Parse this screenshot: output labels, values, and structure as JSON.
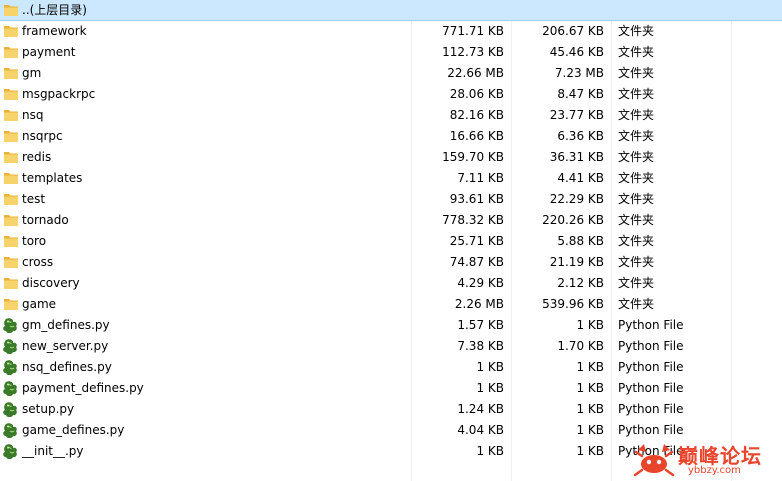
{
  "parent": {
    "label": "..(上层目录)",
    "icon": "folder-icon"
  },
  "columns": {},
  "rows": [
    {
      "name": "framework",
      "size": "771.71 KB",
      "packed": "206.67 KB",
      "type": "文件夹",
      "icon": "folder-icon"
    },
    {
      "name": "payment",
      "size": "112.73 KB",
      "packed": "45.46 KB",
      "type": "文件夹",
      "icon": "folder-icon"
    },
    {
      "name": "gm",
      "size": "22.66 MB",
      "packed": "7.23 MB",
      "type": "文件夹",
      "icon": "folder-icon"
    },
    {
      "name": "msgpackrpc",
      "size": "28.06 KB",
      "packed": "8.47 KB",
      "type": "文件夹",
      "icon": "folder-icon"
    },
    {
      "name": "nsq",
      "size": "82.16 KB",
      "packed": "23.77 KB",
      "type": "文件夹",
      "icon": "folder-icon"
    },
    {
      "name": "nsqrpc",
      "size": "16.66 KB",
      "packed": "6.36 KB",
      "type": "文件夹",
      "icon": "folder-icon"
    },
    {
      "name": "redis",
      "size": "159.70 KB",
      "packed": "36.31 KB",
      "type": "文件夹",
      "icon": "folder-icon"
    },
    {
      "name": "templates",
      "size": "7.11 KB",
      "packed": "4.41 KB",
      "type": "文件夹",
      "icon": "folder-icon"
    },
    {
      "name": "test",
      "size": "93.61 KB",
      "packed": "22.29 KB",
      "type": "文件夹",
      "icon": "folder-icon"
    },
    {
      "name": "tornado",
      "size": "778.32 KB",
      "packed": "220.26 KB",
      "type": "文件夹",
      "icon": "folder-icon"
    },
    {
      "name": "toro",
      "size": "25.71 KB",
      "packed": "5.88 KB",
      "type": "文件夹",
      "icon": "folder-icon"
    },
    {
      "name": "cross",
      "size": "74.87 KB",
      "packed": "21.19 KB",
      "type": "文件夹",
      "icon": "folder-icon"
    },
    {
      "name": "discovery",
      "size": "4.29 KB",
      "packed": "2.12 KB",
      "type": "文件夹",
      "icon": "folder-icon"
    },
    {
      "name": "game",
      "size": "2.26 MB",
      "packed": "539.96 KB",
      "type": "文件夹",
      "icon": "folder-icon"
    },
    {
      "name": "gm_defines.py",
      "size": "1.57 KB",
      "packed": "1 KB",
      "type": "Python File",
      "icon": "python-file-icon"
    },
    {
      "name": "new_server.py",
      "size": "7.38 KB",
      "packed": "1.70 KB",
      "type": "Python File",
      "icon": "python-file-icon"
    },
    {
      "name": "nsq_defines.py",
      "size": "1 KB",
      "packed": "1 KB",
      "type": "Python File",
      "icon": "python-file-icon"
    },
    {
      "name": "payment_defines.py",
      "size": "1 KB",
      "packed": "1 KB",
      "type": "Python File",
      "icon": "python-file-icon"
    },
    {
      "name": "setup.py",
      "size": "1.24 KB",
      "packed": "1 KB",
      "type": "Python File",
      "icon": "python-file-icon"
    },
    {
      "name": "game_defines.py",
      "size": "4.04 KB",
      "packed": "1 KB",
      "type": "Python File",
      "icon": "python-file-icon"
    },
    {
      "name": "__init__.py",
      "size": "1 KB",
      "packed": "1 KB",
      "type": "Python File",
      "icon": "python-file-icon"
    }
  ],
  "watermark": {
    "title": "巅峰论坛",
    "subtitle": "ybbzy.com",
    "icon": "crab-logo-icon"
  },
  "colors": {
    "selection": "#cce8ff",
    "folder": "#f3c553",
    "python": "#3a7a2a",
    "watermark": "#e8452c"
  }
}
